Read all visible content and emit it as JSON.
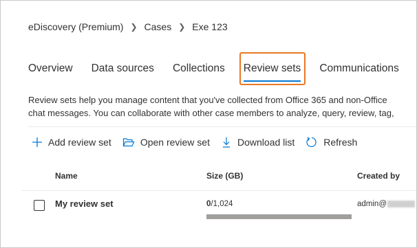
{
  "breadcrumb": {
    "items": [
      "eDiscovery (Premium)",
      "Cases",
      "Exe 123"
    ]
  },
  "tabs": [
    {
      "label": "Overview",
      "active": false
    },
    {
      "label": "Data sources",
      "active": false
    },
    {
      "label": "Collections",
      "active": false
    },
    {
      "label": "Review sets",
      "active": true
    },
    {
      "label": "Communications",
      "active": false
    }
  ],
  "description": {
    "line1": "Review sets help you manage content that you've collected from Office 365 and non-Office",
    "line2": "chat messages. You can collaborate with other case members to analyze, query, review, tag,"
  },
  "commandbar": {
    "add_label": "Add review set",
    "open_label": "Open review set",
    "download_label": "Download list",
    "refresh_label": "Refresh"
  },
  "table": {
    "columns": [
      "Name",
      "Size (GB)",
      "Created by"
    ],
    "rows": [
      {
        "name": "My review set",
        "size_used": "0",
        "size_total": "/1,024",
        "size_fraction": 0,
        "created_by": "admin@"
      }
    ]
  },
  "colors": {
    "accent": "#0078d4",
    "highlight_box": "#e87722",
    "progress_track": "#a19f9d"
  },
  "icons": {
    "add": "plus-icon",
    "open": "folder-open-icon",
    "download": "download-icon",
    "refresh": "refresh-icon"
  }
}
